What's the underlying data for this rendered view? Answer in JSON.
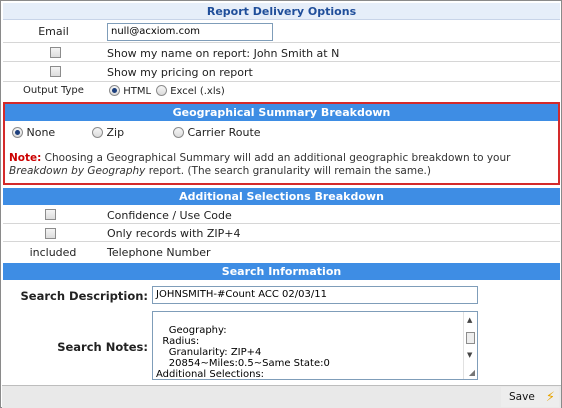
{
  "report_delivery": {
    "header": "Report Delivery Options",
    "email_label": "Email",
    "email_value": "null@acxiom.com",
    "show_name_label": "Show my name on report: John Smith at N",
    "show_pricing_label": "Show my pricing on report",
    "output_type_label": "Output Type",
    "output_html_label": "HTML",
    "output_excel_label": "Excel (.xls)",
    "output_selected": "HTML"
  },
  "geo_summary": {
    "header": "Geographical Summary Breakdown",
    "options": [
      "None",
      "Zip",
      "Carrier Route"
    ],
    "selected": "None",
    "note_label": "Note:",
    "note_text_1": " Choosing a Geographical Summary will add an additional geographic breakdown to your ",
    "note_italic": "Breakdown by Geography",
    "note_text_2": " report. (The search granularity will remain the same.)"
  },
  "additional_selections": {
    "header": "Additional Selections Breakdown",
    "items": [
      {
        "status": "",
        "label": "Confidence / Use Code"
      },
      {
        "status": "",
        "label": "Only records with ZIP+4"
      },
      {
        "status": "included",
        "label": "Telephone Number"
      }
    ]
  },
  "search_info": {
    "header": "Search Information",
    "description_label": "Search Description:",
    "description_value": "JOHNSMITH-#Count  ACC  02/03/11",
    "notes_label": "Search Notes:",
    "notes_value": "Geography:\n  Radius:\n    Granularity: ZIP+4\n    20854~Miles:0.5~Same State:0\nAdditional Selections:"
  },
  "footer": {
    "save_label": "Save",
    "save_icon": "lightning-icon"
  }
}
